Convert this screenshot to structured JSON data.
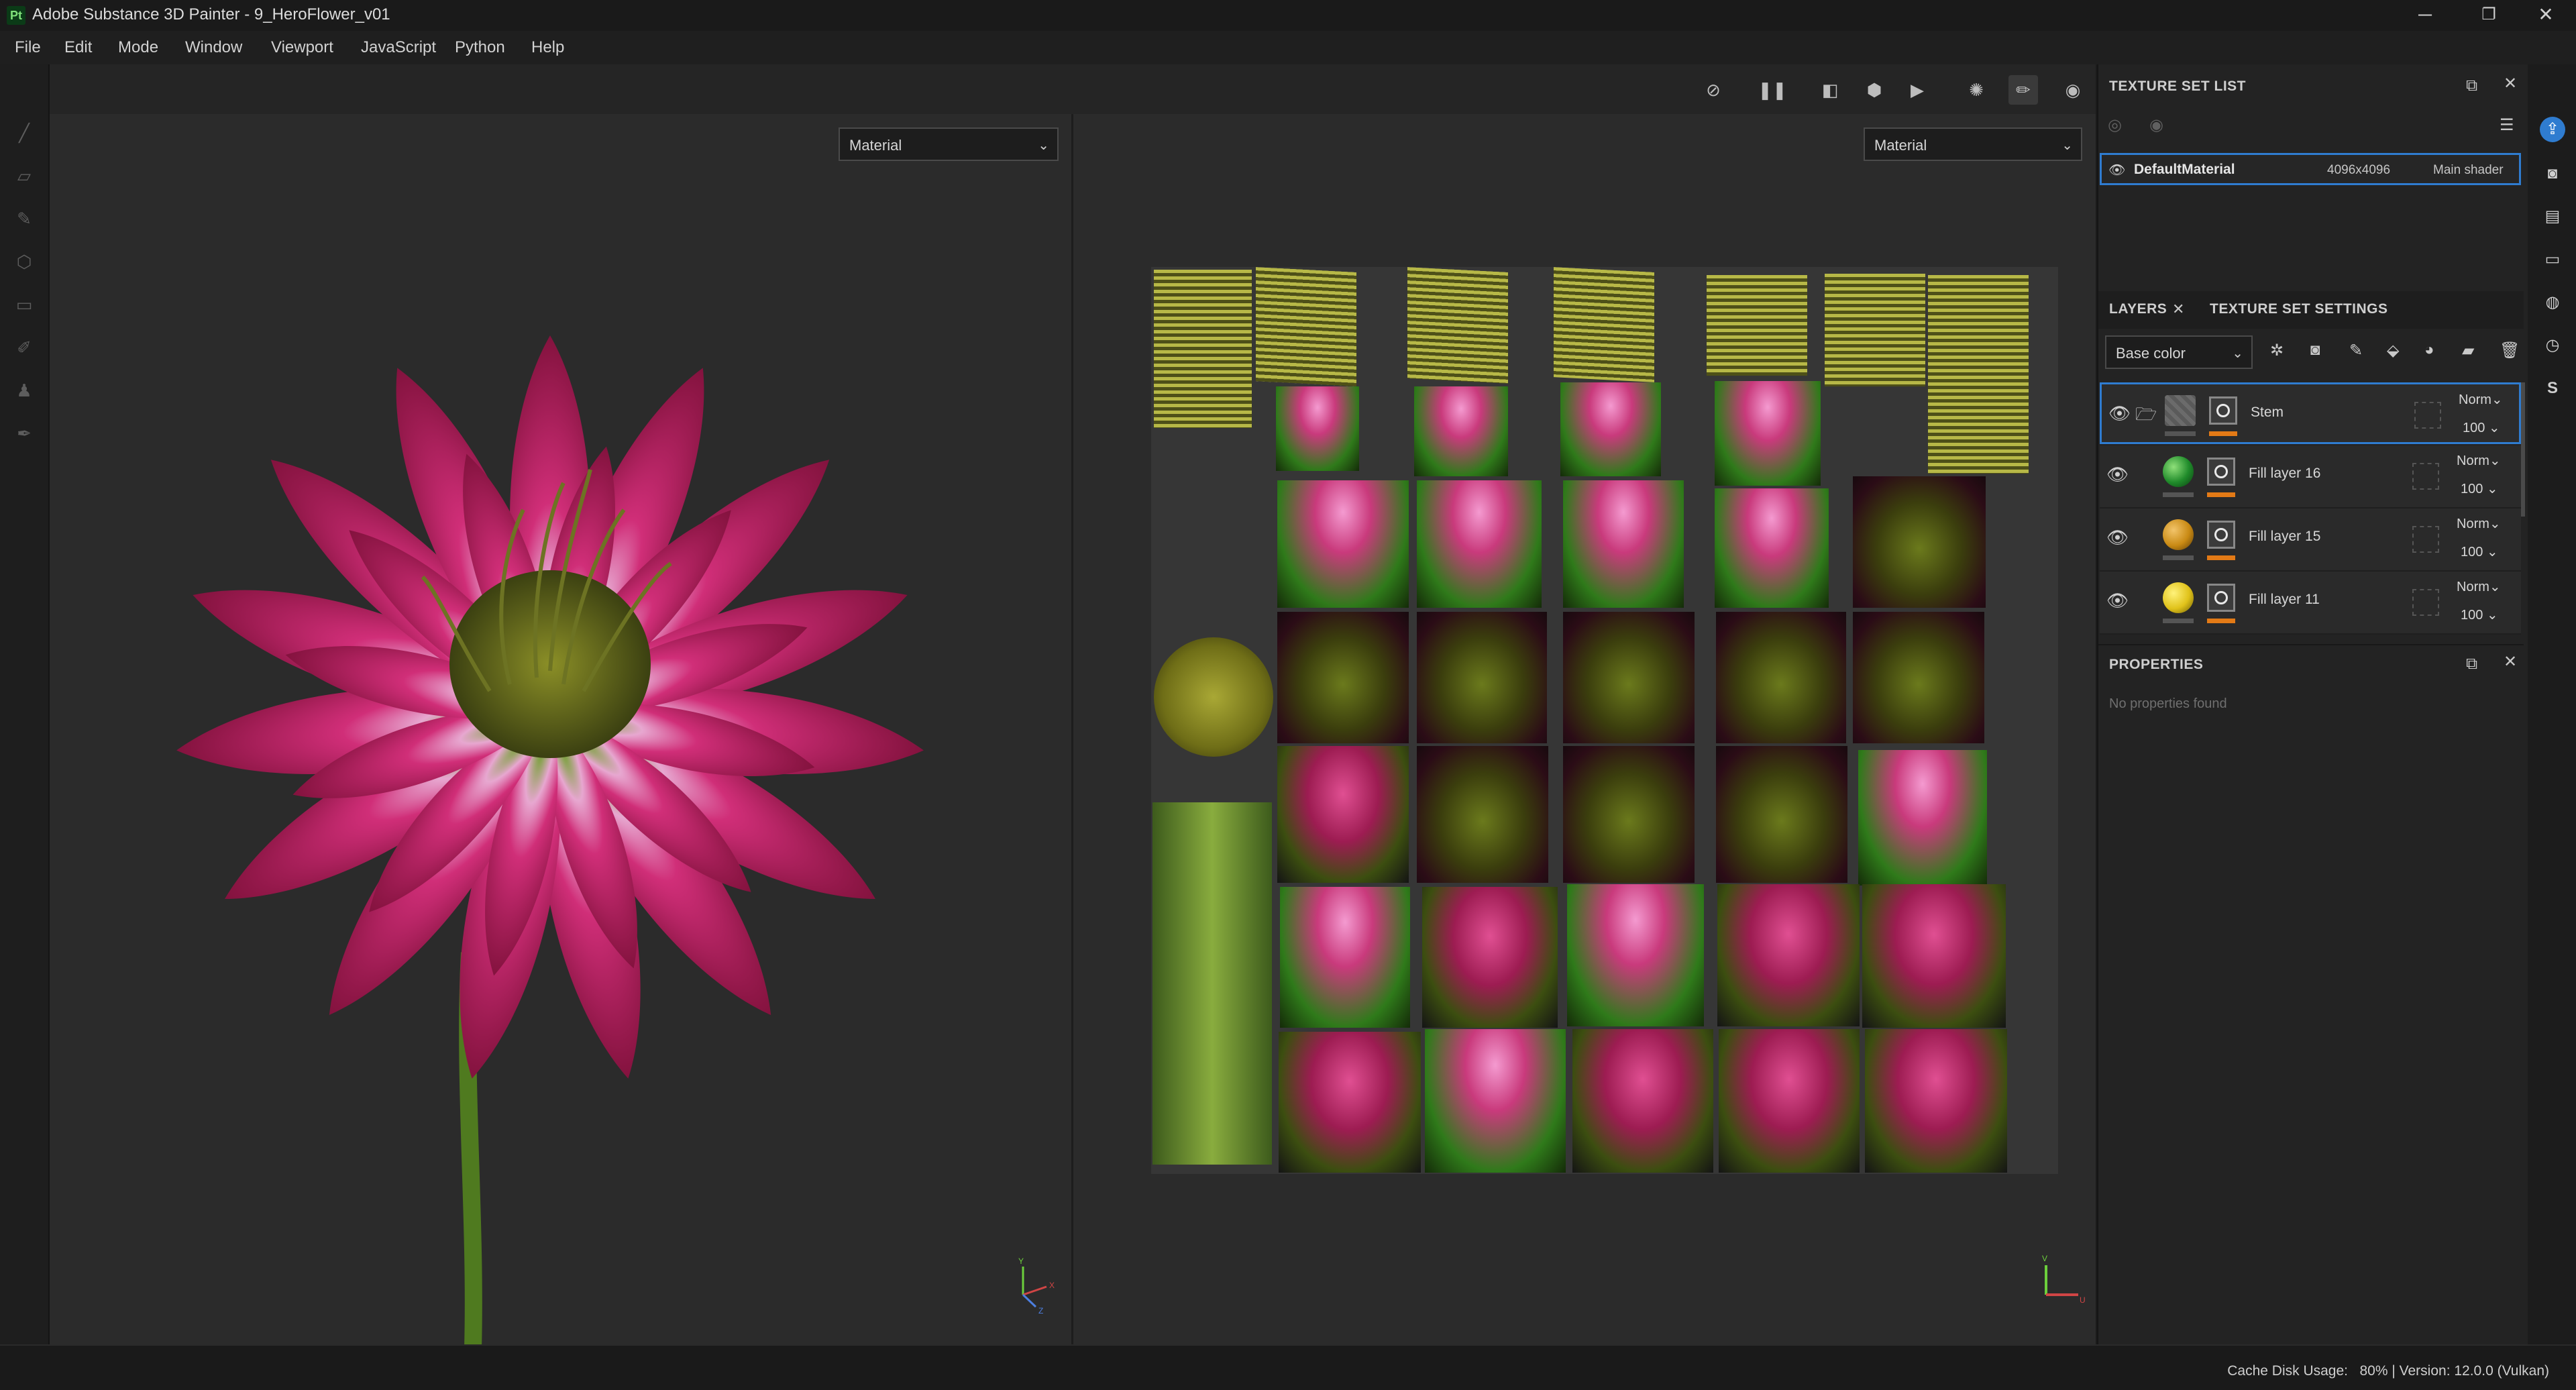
{
  "window": {
    "title": "Adobe Substance 3D Painter - 9_HeroFlower_v01",
    "logo": "Pt",
    "controls": [
      "─",
      "❐",
      "✕"
    ]
  },
  "menu": [
    "File",
    "Edit",
    "Mode",
    "Window",
    "Viewport",
    "JavaScript",
    "Python",
    "Help"
  ],
  "viewport": {
    "left_mode": "Material",
    "right_mode": "Material",
    "left_axis": {
      "x": "X",
      "y": "Y",
      "z": "Z"
    },
    "right_axis": {
      "u": "U",
      "v": "V"
    }
  },
  "texture_set_list": {
    "title": "TEXTURE SET LIST",
    "item": {
      "name": "DefaultMaterial",
      "resolution": "4096x4096",
      "shader": "Main shader"
    }
  },
  "layers_panel": {
    "tabs": [
      "LAYERS",
      "TEXTURE SET SETTINGS"
    ],
    "channel": "Base color",
    "layers": [
      {
        "name": "Stem",
        "blend": "Norm",
        "opacity": "100",
        "type": "folder",
        "color": "#7a7a7a"
      },
      {
        "name": "Fill layer 16",
        "blend": "Norm",
        "opacity": "100",
        "type": "fill",
        "color": "#1f8a2a"
      },
      {
        "name": "Fill layer 15",
        "blend": "Norm",
        "opacity": "100",
        "type": "fill",
        "color": "#c98a14"
      },
      {
        "name": "Fill layer 11",
        "blend": "Norm",
        "opacity": "100",
        "type": "fill",
        "color": "#e0c21a"
      }
    ]
  },
  "properties": {
    "title": "PROPERTIES",
    "empty_text": "No properties found"
  },
  "status": {
    "text": "Cache Disk Usage:   80% | Version: 12.0.0 (Vulkan)"
  },
  "colors": {
    "accent": "#2f7cd0",
    "orange": "#e37a16",
    "panel": "#232323"
  }
}
